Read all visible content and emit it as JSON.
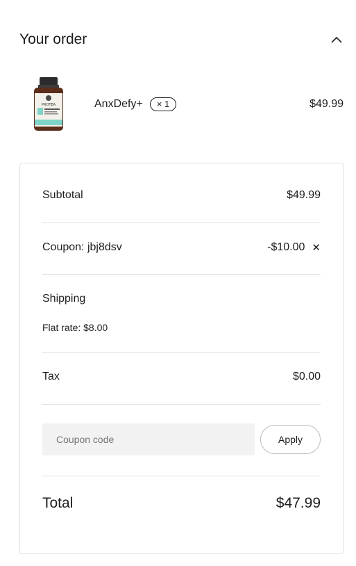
{
  "header": {
    "title": "Your order",
    "toggle_icon": "chevron-up-icon"
  },
  "item": {
    "name": "AnxDefy+",
    "quantity": "× 1",
    "price": "$49.99",
    "image_icon": "supplement-bottle-icon",
    "bottle_brand": "PROTEA"
  },
  "summary": {
    "subtotal": {
      "label": "Subtotal",
      "value": "$49.99"
    },
    "coupon": {
      "label": "Coupon: jbj8dsv",
      "value": "-$10.00",
      "remove_icon": "close-icon"
    },
    "shipping": {
      "label": "Shipping",
      "method": "Flat rate: $8.00"
    },
    "tax": {
      "label": "Tax",
      "value": "$0.00"
    },
    "coupon_form": {
      "placeholder": "Coupon code",
      "apply_label": "Apply"
    },
    "total": {
      "label": "Total",
      "value": "$47.99"
    }
  },
  "colors": {
    "text": "#1e1e1e",
    "border": "#e0e0e0",
    "input_bg": "#f2f2f2",
    "bottle_cap": "#2b2b2b",
    "bottle_body": "#5a2e1a",
    "label_accent": "#7fd3c7"
  }
}
